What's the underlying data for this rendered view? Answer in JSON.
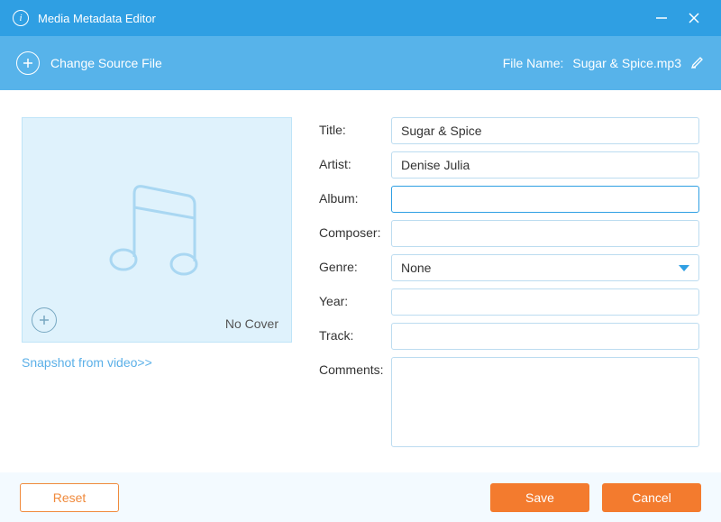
{
  "titlebar": {
    "title": "Media Metadata Editor"
  },
  "toolbar": {
    "change_source_label": "Change Source File",
    "filename_label": "File Name:",
    "filename_value": "Sugar & Spice.mp3"
  },
  "cover": {
    "no_cover_label": "No Cover",
    "snapshot_link": "Snapshot from video>>"
  },
  "form": {
    "labels": {
      "title": "Title:",
      "artist": "Artist:",
      "album": "Album:",
      "composer": "Composer:",
      "genre": "Genre:",
      "year": "Year:",
      "track": "Track:",
      "comments": "Comments:"
    },
    "values": {
      "title": "Sugar & Spice",
      "artist": "Denise Julia",
      "album": "",
      "composer": "",
      "genre": "None",
      "year": "",
      "track": "",
      "comments": ""
    }
  },
  "footer": {
    "reset": "Reset",
    "save": "Save",
    "cancel": "Cancel"
  }
}
